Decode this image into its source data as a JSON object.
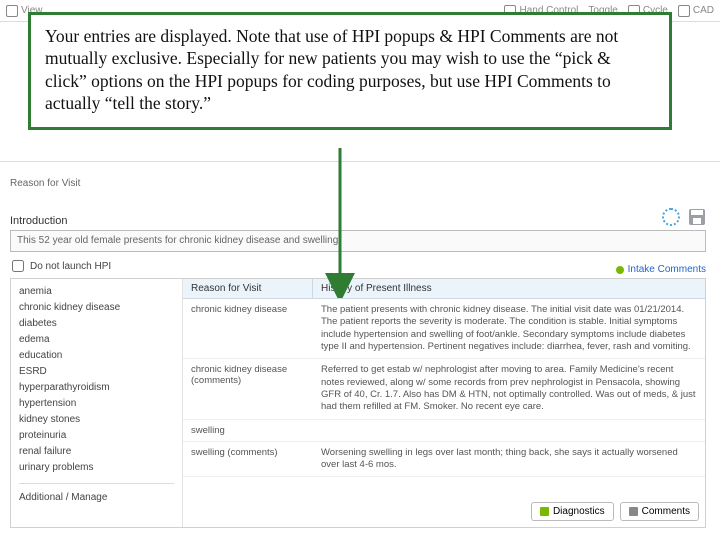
{
  "toolbar": {
    "view": "View",
    "cad": "CAD",
    "hand": "Hand Control",
    "toggle": "Toggle",
    "cycle": "Cycle"
  },
  "section_label": "Reason for Visit",
  "intro": {
    "heading": "Introduction",
    "text": "This 52 year old female presents for chronic kidney disease and swelling."
  },
  "launch_label": "Do not launch HPI",
  "intake_link": "Intake Comments",
  "sidebar": {
    "items": [
      "anemia",
      "chronic kidney disease",
      "diabetes",
      "edema",
      "education",
      "ESRD",
      "hyperparathyroidism",
      "hypertension",
      "kidney stones",
      "proteinuria",
      "renal failure",
      "urinary problems"
    ],
    "manage": "Additional / Manage"
  },
  "headers": {
    "col1": "Reason for Visit",
    "col2": "History of Present Illness"
  },
  "rows": [
    {
      "c1": "chronic kidney disease",
      "c2": "The patient presents with chronic kidney disease. The initial visit date was 01/21/2014. The patient reports the severity is moderate. The condition is stable. Initial symptoms include hypertension and swelling of foot/ankle. Secondary symptoms include diabetes type II and hypertension. Pertinent negatives include: diarrhea, fever, rash and vomiting."
    },
    {
      "c1": "chronic kidney disease (comments)",
      "c2": "Referred to get estab w/ nephrologist after moving to area. Family Medicine's recent notes reviewed, along w/ some records from prev nephrologist in Pensacola, showing GFR of 40, Cr. 1.7. Also has DM & HTN, not optimally controlled. Was out of meds, & just had them refilled at FM. Smoker. No recent eye care."
    },
    {
      "c1": "swelling",
      "c2": ""
    },
    {
      "c1": "swelling (comments)",
      "c2": "Worsening swelling in legs over last month; thing back, she says it actually worsened over last 4-6 mos."
    }
  ],
  "buttons": {
    "diag": "Diagnostics",
    "comm": "Comments"
  },
  "callout": "Your entries are displayed.  Note that use of HPI popups & HPI Comments are not mutually exclusive.  Especially for new patients you may wish to use the “pick & click” options on the HPI popups for coding purposes, but use HPI Comments to actually “tell the story.”"
}
